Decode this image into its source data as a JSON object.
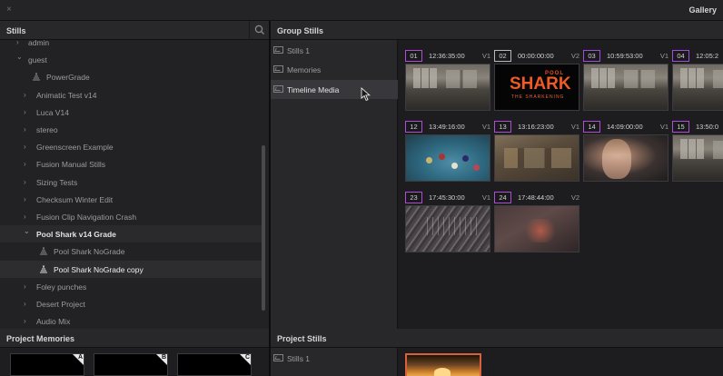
{
  "window": {
    "title": "Gallery",
    "close": "×"
  },
  "stills_panel": {
    "title": "Stills",
    "tree": [
      {
        "label": "admin",
        "kind": "folder-collapsed",
        "indent": 0,
        "partial": true
      },
      {
        "label": "guest",
        "kind": "folder-open",
        "indent": 0
      },
      {
        "label": "PowerGrade",
        "kind": "album",
        "indent": 1
      },
      {
        "label": "Animatic Test v14",
        "kind": "folder-collapsed",
        "indent": 1
      },
      {
        "label": "Luca V14",
        "kind": "folder-collapsed",
        "indent": 1
      },
      {
        "label": "stereo",
        "kind": "folder-collapsed",
        "indent": 1
      },
      {
        "label": "Greenscreen Example",
        "kind": "folder-collapsed",
        "indent": 1
      },
      {
        "label": "Fusion Manual Stills",
        "kind": "folder-collapsed",
        "indent": 1
      },
      {
        "label": "Sizing Tests",
        "kind": "folder-collapsed",
        "indent": 1
      },
      {
        "label": "Checksum Winter Edit",
        "kind": "folder-collapsed",
        "indent": 1
      },
      {
        "label": "Fusion Clip Navigation Crash",
        "kind": "folder-collapsed",
        "indent": 1
      },
      {
        "label": "Pool Shark v14 Grade",
        "kind": "folder-open-active",
        "indent": 1
      },
      {
        "label": "Pool Shark NoGrade",
        "kind": "album",
        "indent": 2
      },
      {
        "label": "Pool Shark NoGrade copy",
        "kind": "album-selected",
        "indent": 2
      },
      {
        "label": "Foley punches",
        "kind": "folder-collapsed",
        "indent": 1
      },
      {
        "label": "Desert Project",
        "kind": "folder-collapsed",
        "indent": 1
      },
      {
        "label": "Audio Mix",
        "kind": "folder-collapsed",
        "indent": 1
      }
    ]
  },
  "project_memories": {
    "title": "Project Memories",
    "slots": [
      "A",
      "B",
      "C"
    ]
  },
  "group_stills": {
    "title": "Group Stills",
    "albums": [
      {
        "label": "Stills 1",
        "selected": false
      },
      {
        "label": "Memories",
        "selected": false
      },
      {
        "label": "Timeline Media",
        "selected": true
      }
    ],
    "stills": [
      {
        "num": "01",
        "tc": "12:36:35:00",
        "ver": "V1",
        "accent": "#b04dd6",
        "thumb": "t-office"
      },
      {
        "num": "02",
        "tc": "00:00:00:00",
        "ver": "V2",
        "accent": "#b8b8b8",
        "thumb": "t-title"
      },
      {
        "num": "03",
        "tc": "10:59:53:00",
        "ver": "V1",
        "accent": "#9e4de0",
        "thumb": "t-office"
      },
      {
        "num": "04",
        "tc": "12:05:2",
        "ver": "",
        "accent": "#9e4de0",
        "thumb": "t-office"
      },
      {
        "num": "12",
        "tc": "13:49:16:00",
        "ver": "V1",
        "accent": "#b04dd6",
        "thumb": "t-pool"
      },
      {
        "num": "13",
        "tc": "13:16:23:00",
        "ver": "V1",
        "accent": "#b04dd6",
        "thumb": "t-room"
      },
      {
        "num": "14",
        "tc": "14:09:00:00",
        "ver": "V1",
        "accent": "#b04dd6",
        "thumb": "t-face"
      },
      {
        "num": "15",
        "tc": "13:50:0",
        "ver": "",
        "accent": "#b04dd6",
        "thumb": "t-office"
      },
      {
        "num": "23",
        "tc": "17:45:30:00",
        "ver": "V1",
        "accent": "#b04dd6",
        "thumb": "t-wall"
      },
      {
        "num": "24",
        "tc": "17:48:44:00",
        "ver": "V2",
        "accent": "#b04dd6",
        "thumb": "t-gritty"
      }
    ],
    "title_card": {
      "pool": "POOL",
      "shark": "SHARK",
      "subtitle": "THE SHARKENING"
    }
  },
  "project_stills": {
    "title": "Project Stills",
    "albums": [
      {
        "label": "Stills 1"
      }
    ]
  }
}
